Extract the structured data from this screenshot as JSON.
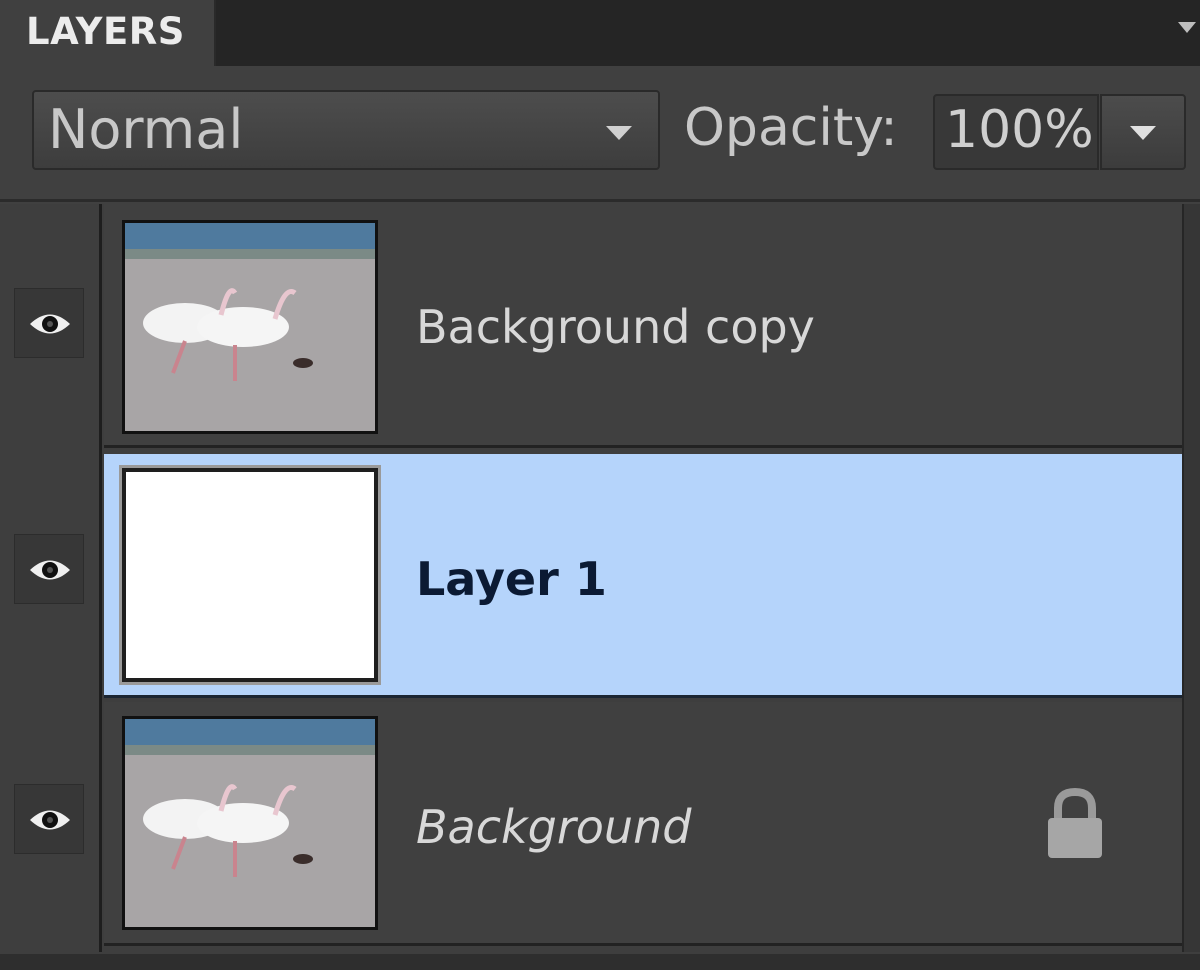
{
  "panel": {
    "tab_label": "LAYERS",
    "menu_icon": "panel-menu-icon"
  },
  "toolbar": {
    "blend_mode": "Normal",
    "opacity_label": "Opacity:",
    "opacity_value": "100%"
  },
  "layers": [
    {
      "name": "Background copy",
      "visible": true,
      "selected": false,
      "thumbnail": "photo-birds",
      "locked": false,
      "italic": false
    },
    {
      "name": "Layer 1",
      "visible": true,
      "selected": true,
      "thumbnail": "white",
      "locked": false,
      "italic": false
    },
    {
      "name": "Background",
      "visible": true,
      "selected": false,
      "thumbnail": "photo-birds",
      "locked": true,
      "italic": true
    }
  ],
  "colors": {
    "panel_bg": "#404040",
    "selected_row": "#b5d4fb",
    "text": "#d8d8d8"
  },
  "icons": {
    "visibility": "eye-icon",
    "lock": "lock-icon",
    "dropdown": "chevron-down-icon"
  }
}
